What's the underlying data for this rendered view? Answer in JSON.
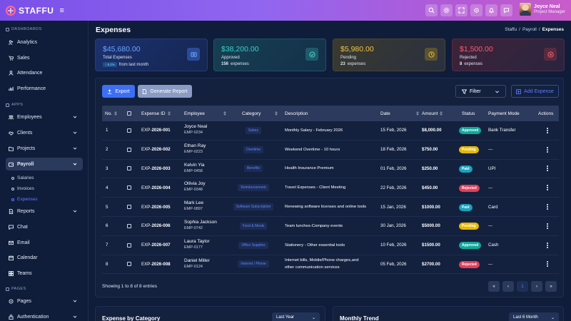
{
  "app": {
    "brand": "STAFFU"
  },
  "user": {
    "name": "Joyce Neal",
    "role": "Project Manager"
  },
  "sidebar": {
    "sections": [
      {
        "label": "DASHBOARDS"
      },
      {
        "label": "APPS"
      },
      {
        "label": "PAGES"
      }
    ],
    "items": [
      {
        "label": "Analytics",
        "icon": "users-icon"
      },
      {
        "label": "Sales",
        "icon": "cart-icon"
      },
      {
        "label": "Attendance",
        "icon": "person-icon"
      },
      {
        "label": "Performance",
        "icon": "bar-chart-icon"
      },
      {
        "label": "Employees",
        "icon": "user-group-icon"
      },
      {
        "label": "Clients",
        "icon": "handshake-icon"
      },
      {
        "label": "Projects",
        "icon": "folder-icon"
      },
      {
        "label": "Payroll",
        "icon": "wallet-icon"
      },
      {
        "label": "Reports",
        "icon": "document-icon"
      },
      {
        "label": "Chat",
        "icon": "chat-icon"
      },
      {
        "label": "Email",
        "icon": "mail-icon"
      },
      {
        "label": "Calendar",
        "icon": "calendar-icon"
      },
      {
        "label": "Teams",
        "icon": "team-icon"
      },
      {
        "label": "Pages",
        "icon": "pages-icon"
      },
      {
        "label": "Authentication",
        "icon": "lock-icon"
      }
    ],
    "payroll_sub": [
      "Salaries",
      "Invoices",
      "Expenses"
    ]
  },
  "page": {
    "title": "Expenses",
    "breadcrumb": [
      "Staffu",
      "/",
      "Payroll",
      "/",
      "Expenses"
    ]
  },
  "cards": [
    {
      "amount": "$45,680.00",
      "label": "Total Expenses",
      "trend": "↑ 8.2%",
      "meta": "from last month",
      "color": "#5aa0ff"
    },
    {
      "amount": "$38,200.00",
      "label": "Approved",
      "count": "156",
      "meta": "expenses",
      "color": "#2fd0c8"
    },
    {
      "amount": "$5,980.00",
      "label": "Pending",
      "count": "23",
      "meta": "expenses",
      "color": "#f5c542"
    },
    {
      "amount": "$1,500.00",
      "label": "Rejected",
      "count": "8",
      "meta": "expenses",
      "color": "#ff5a6e"
    }
  ],
  "toolbar": {
    "export": "Export",
    "report": "Generate Report",
    "filter": "Filter",
    "add": "Add Expense"
  },
  "table": {
    "headers": [
      "No.",
      "Expense ID",
      "Employee",
      "Category",
      "Description",
      "Date",
      "Amount",
      "Status",
      "Payment Mode",
      "Actions"
    ],
    "rows": [
      {
        "no": "1",
        "idp": "EXP-",
        "idn": "2026-001",
        "name": "Joyce Neal",
        "emp": "EMP-0234",
        "cat": "Salary",
        "desc": "Monthly Salary - February 2026",
        "desc2": "",
        "date": "15 Feb, 2026",
        "amt": "$8,000.00",
        "status": "Approved",
        "mode": "Bank Transfer"
      },
      {
        "no": "2",
        "idp": "EXP-",
        "idn": "2026-002",
        "name": "Ethan Ray",
        "emp": "EMP-0223",
        "cat": "Overtime",
        "desc": "Weekend Overtime - 10 hours",
        "desc2": "",
        "date": "18 Feb, 2026",
        "amt": "$750.00",
        "status": "Pending",
        "mode": "---"
      },
      {
        "no": "3",
        "idp": "EXP-",
        "idn": "2026-003",
        "name": "Kelvin Yia",
        "emp": "EMP-0458",
        "cat": "Benefits",
        "desc": "Health Insurance Premium",
        "desc2": "",
        "date": "01 Feb, 2026",
        "amt": "$250.00",
        "status": "Paid",
        "mode": "UPI"
      },
      {
        "no": "4",
        "idp": "EXP-",
        "idn": "2026-004",
        "name": "Ollivia Joy",
        "emp": "EMP-0348",
        "cat": "Reimbursement",
        "desc": "Travel Expenses - Client Meeting",
        "desc2": "",
        "date": "22 Feb, 2026",
        "amt": "$450.00",
        "status": "Rejected",
        "mode": "---"
      },
      {
        "no": "5",
        "idp": "EXP-",
        "idn": "2026-005",
        "name": "Mark Lee",
        "emp": "EMP-0897",
        "cat": "Software Subscription",
        "desc": "Renewing software licenses and online tools",
        "desc2": "",
        "date": "15 Jan, 2026",
        "amt": "$1000.00",
        "status": "Paid",
        "mode": "Card"
      },
      {
        "no": "6",
        "idp": "EXP-",
        "idn": "2026-006",
        "name": "Sophia Jackson",
        "emp": "EMP-0742",
        "cat": "Food & Meals",
        "desc": "Team lunches-Company events",
        "desc2": "",
        "date": "30 Jan, 2026",
        "amt": "$5000.00",
        "status": "Pending",
        "mode": "---"
      },
      {
        "no": "7",
        "idp": "EXP-",
        "idn": "2026-007",
        "name": "Laura Taylor",
        "emp": "EMP-0177",
        "cat": "Office Supplies",
        "desc": "Stationery - Other essential tools",
        "desc2": "",
        "date": "10 Feb, 2026",
        "amt": "$1500.00",
        "status": "Approved",
        "mode": "Cash"
      },
      {
        "no": "8",
        "idp": "EXP-",
        "idn": "2026-008",
        "name": "Daniel Miller",
        "emp": "EMP-0124",
        "cat": "Internet / Phone",
        "desc": "Internet bills, Mobile/Phone charges,and",
        "desc2": "other communication services",
        "date": "05 Feb, 2026",
        "amt": "$2700.00",
        "status": "Rejected",
        "mode": "---"
      }
    ]
  },
  "status_colors": {
    "Approved": "#12a89a",
    "Pending": "#e6b800",
    "Paid": "#1aa2bd",
    "Rejected": "#e0405a"
  },
  "footer": {
    "showing": "Showing 1 to 8 of 8 entries",
    "pages": [
      "«",
      "‹",
      "1",
      "›",
      "»"
    ]
  },
  "bottom": {
    "left_title": "Expense by Category",
    "left_select": "Last Year",
    "right_title": "Monthly Trend",
    "right_select": "Last 6 Month"
  }
}
